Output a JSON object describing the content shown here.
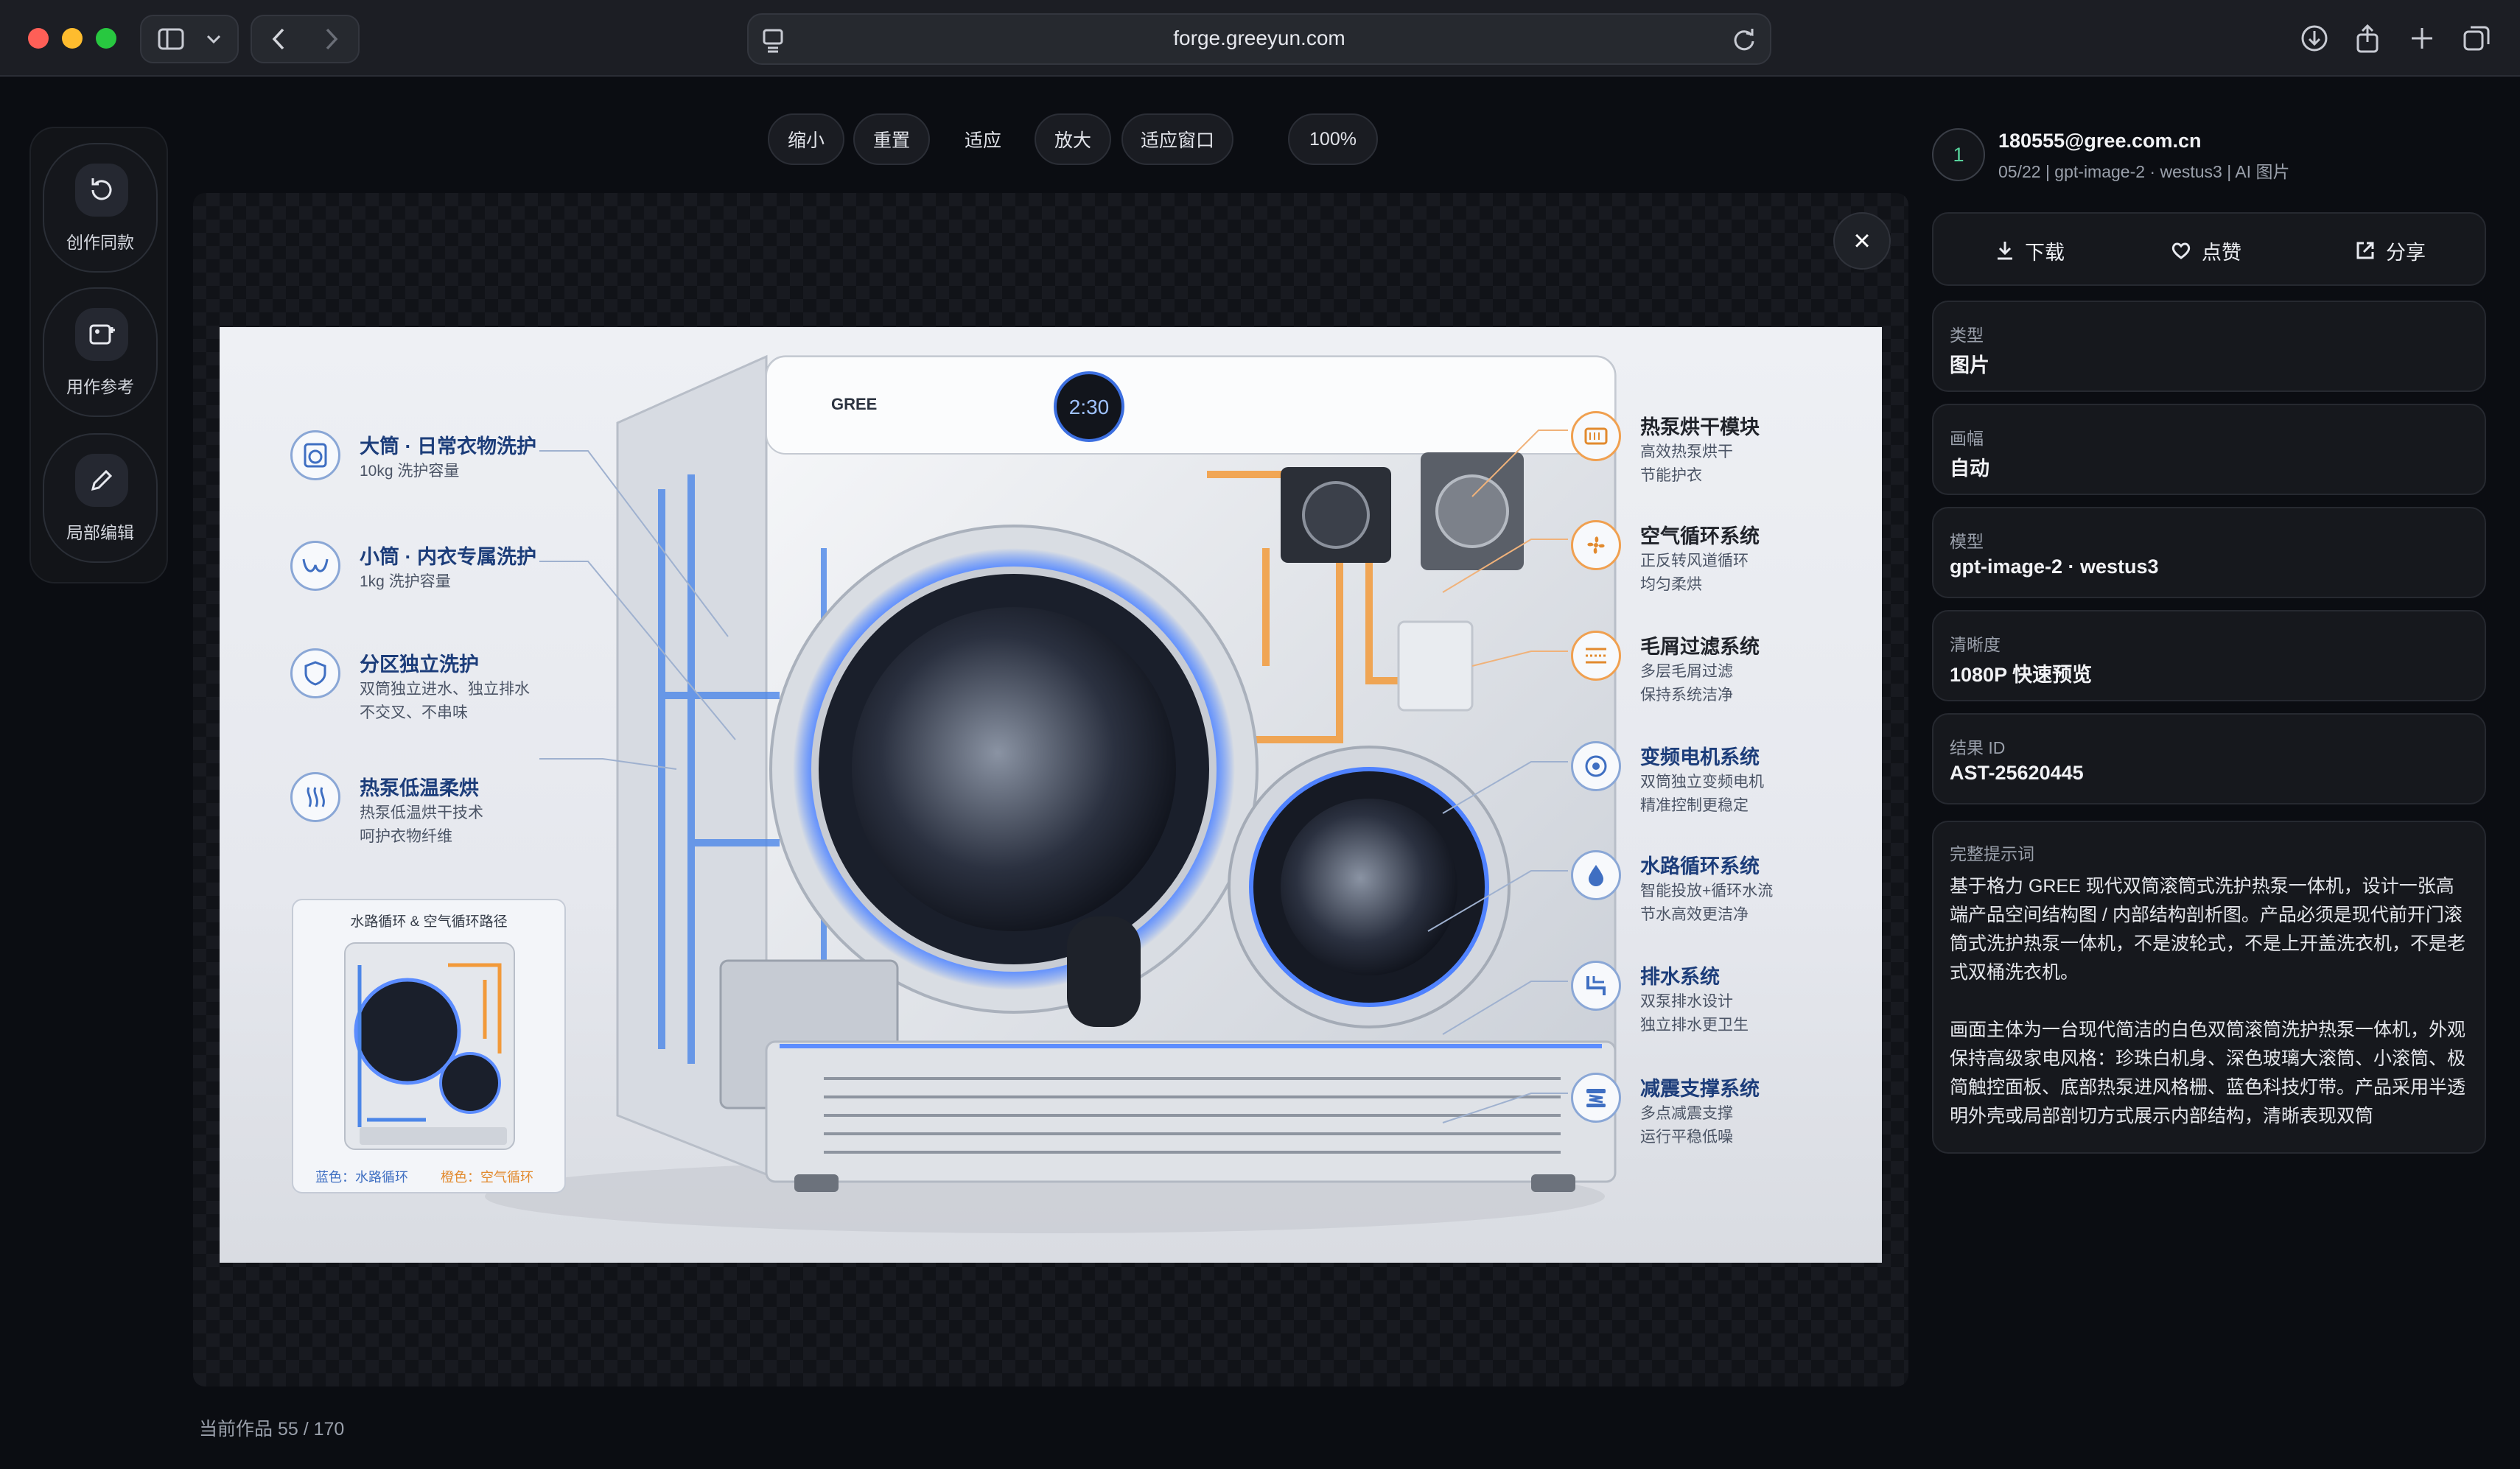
{
  "browser": {
    "url": "forge.greeyun.com"
  },
  "tools": [
    {
      "label": "创作同款"
    },
    {
      "label": "用作参考"
    },
    {
      "label": "局部编辑"
    }
  ],
  "zoom": {
    "zoom_out": "缩小",
    "reset": "重置",
    "fit": "适应",
    "zoom_in": "放大",
    "fit_window": "适应窗口",
    "percent": "100%"
  },
  "close_label": "×",
  "counter": "当前作品 55 / 170",
  "image": {
    "brand": "GREE",
    "display_time": "2:30",
    "left_features": [
      {
        "title": "大筒 · 日常衣物洗护",
        "sub": [
          "10kg 洗护容量"
        ]
      },
      {
        "title": "小筒 · 内衣专属洗护",
        "sub": [
          "1kg 洗护容量"
        ]
      },
      {
        "title": "分区独立洗护",
        "sub": [
          "双筒独立进水、独立排水",
          "不交叉、不串味"
        ]
      },
      {
        "title": "热泵低温柔烘",
        "sub": [
          "热泵低温烘干技术",
          "呵护衣物纤维"
        ]
      }
    ],
    "right_features": [
      {
        "title": "热泵烘干模块",
        "sub": [
          "高效热泵烘干",
          "节能护衣"
        ]
      },
      {
        "title": "空气循环系统",
        "sub": [
          "正反转风道循环",
          "均匀柔烘"
        ]
      },
      {
        "title": "毛屑过滤系统",
        "sub": [
          "多层毛屑过滤",
          "保持系统洁净"
        ]
      },
      {
        "title": "变频电机系统",
        "sub": [
          "双筒独立变频电机",
          "精准控制更稳定"
        ]
      },
      {
        "title": "水路循环系统",
        "sub": [
          "智能投放+循环水流",
          "节水高效更洁净"
        ]
      },
      {
        "title": "排水系统",
        "sub": [
          "双泵排水设计",
          "独立排水更卫生"
        ]
      },
      {
        "title": "减震支撑系统",
        "sub": [
          "多点减震支撑",
          "运行平稳低噪"
        ]
      }
    ],
    "inset": {
      "title": "水路循环 & 空气循环路径",
      "legend_water": "蓝色：水路循环",
      "legend_air": "橙色：空气循环"
    }
  },
  "panel": {
    "avatar": "1",
    "email": "180555@gree.com.cn",
    "meta": "05/22 | gpt-image-2 · westus3 | AI 图片",
    "actions": {
      "download": "下载",
      "like": "点赞",
      "share": "分享"
    },
    "cards": [
      {
        "label": "类型",
        "value": "图片"
      },
      {
        "label": "画幅",
        "value": "自动"
      },
      {
        "label": "模型",
        "value": "gpt-image-2 · westus3"
      },
      {
        "label": "清晰度",
        "value": "1080P 快速预览"
      },
      {
        "label": "结果 ID",
        "value": "AST-25620445"
      }
    ],
    "prompt": {
      "label": "完整提示词",
      "p1": "基于格力 GREE 现代双筒滚筒式洗护热泵一体机，设计一张高端产品空间结构图 / 内部结构剖析图。产品必须是现代前开门滚筒式洗护热泵一体机，不是波轮式，不是上开盖洗衣机，不是老式双桶洗衣机。",
      "p2": "画面主体为一台现代简洁的白色双筒滚筒洗护热泵一体机，外观保持高级家电风格：珍珠白机身、深色玻璃大滚筒、小滚筒、极简触控面板、底部热泵进风格栅、蓝色科技灯带。产品采用半透明外壳或局部剖切方式展示内部结构，清晰表现双筒"
    }
  }
}
